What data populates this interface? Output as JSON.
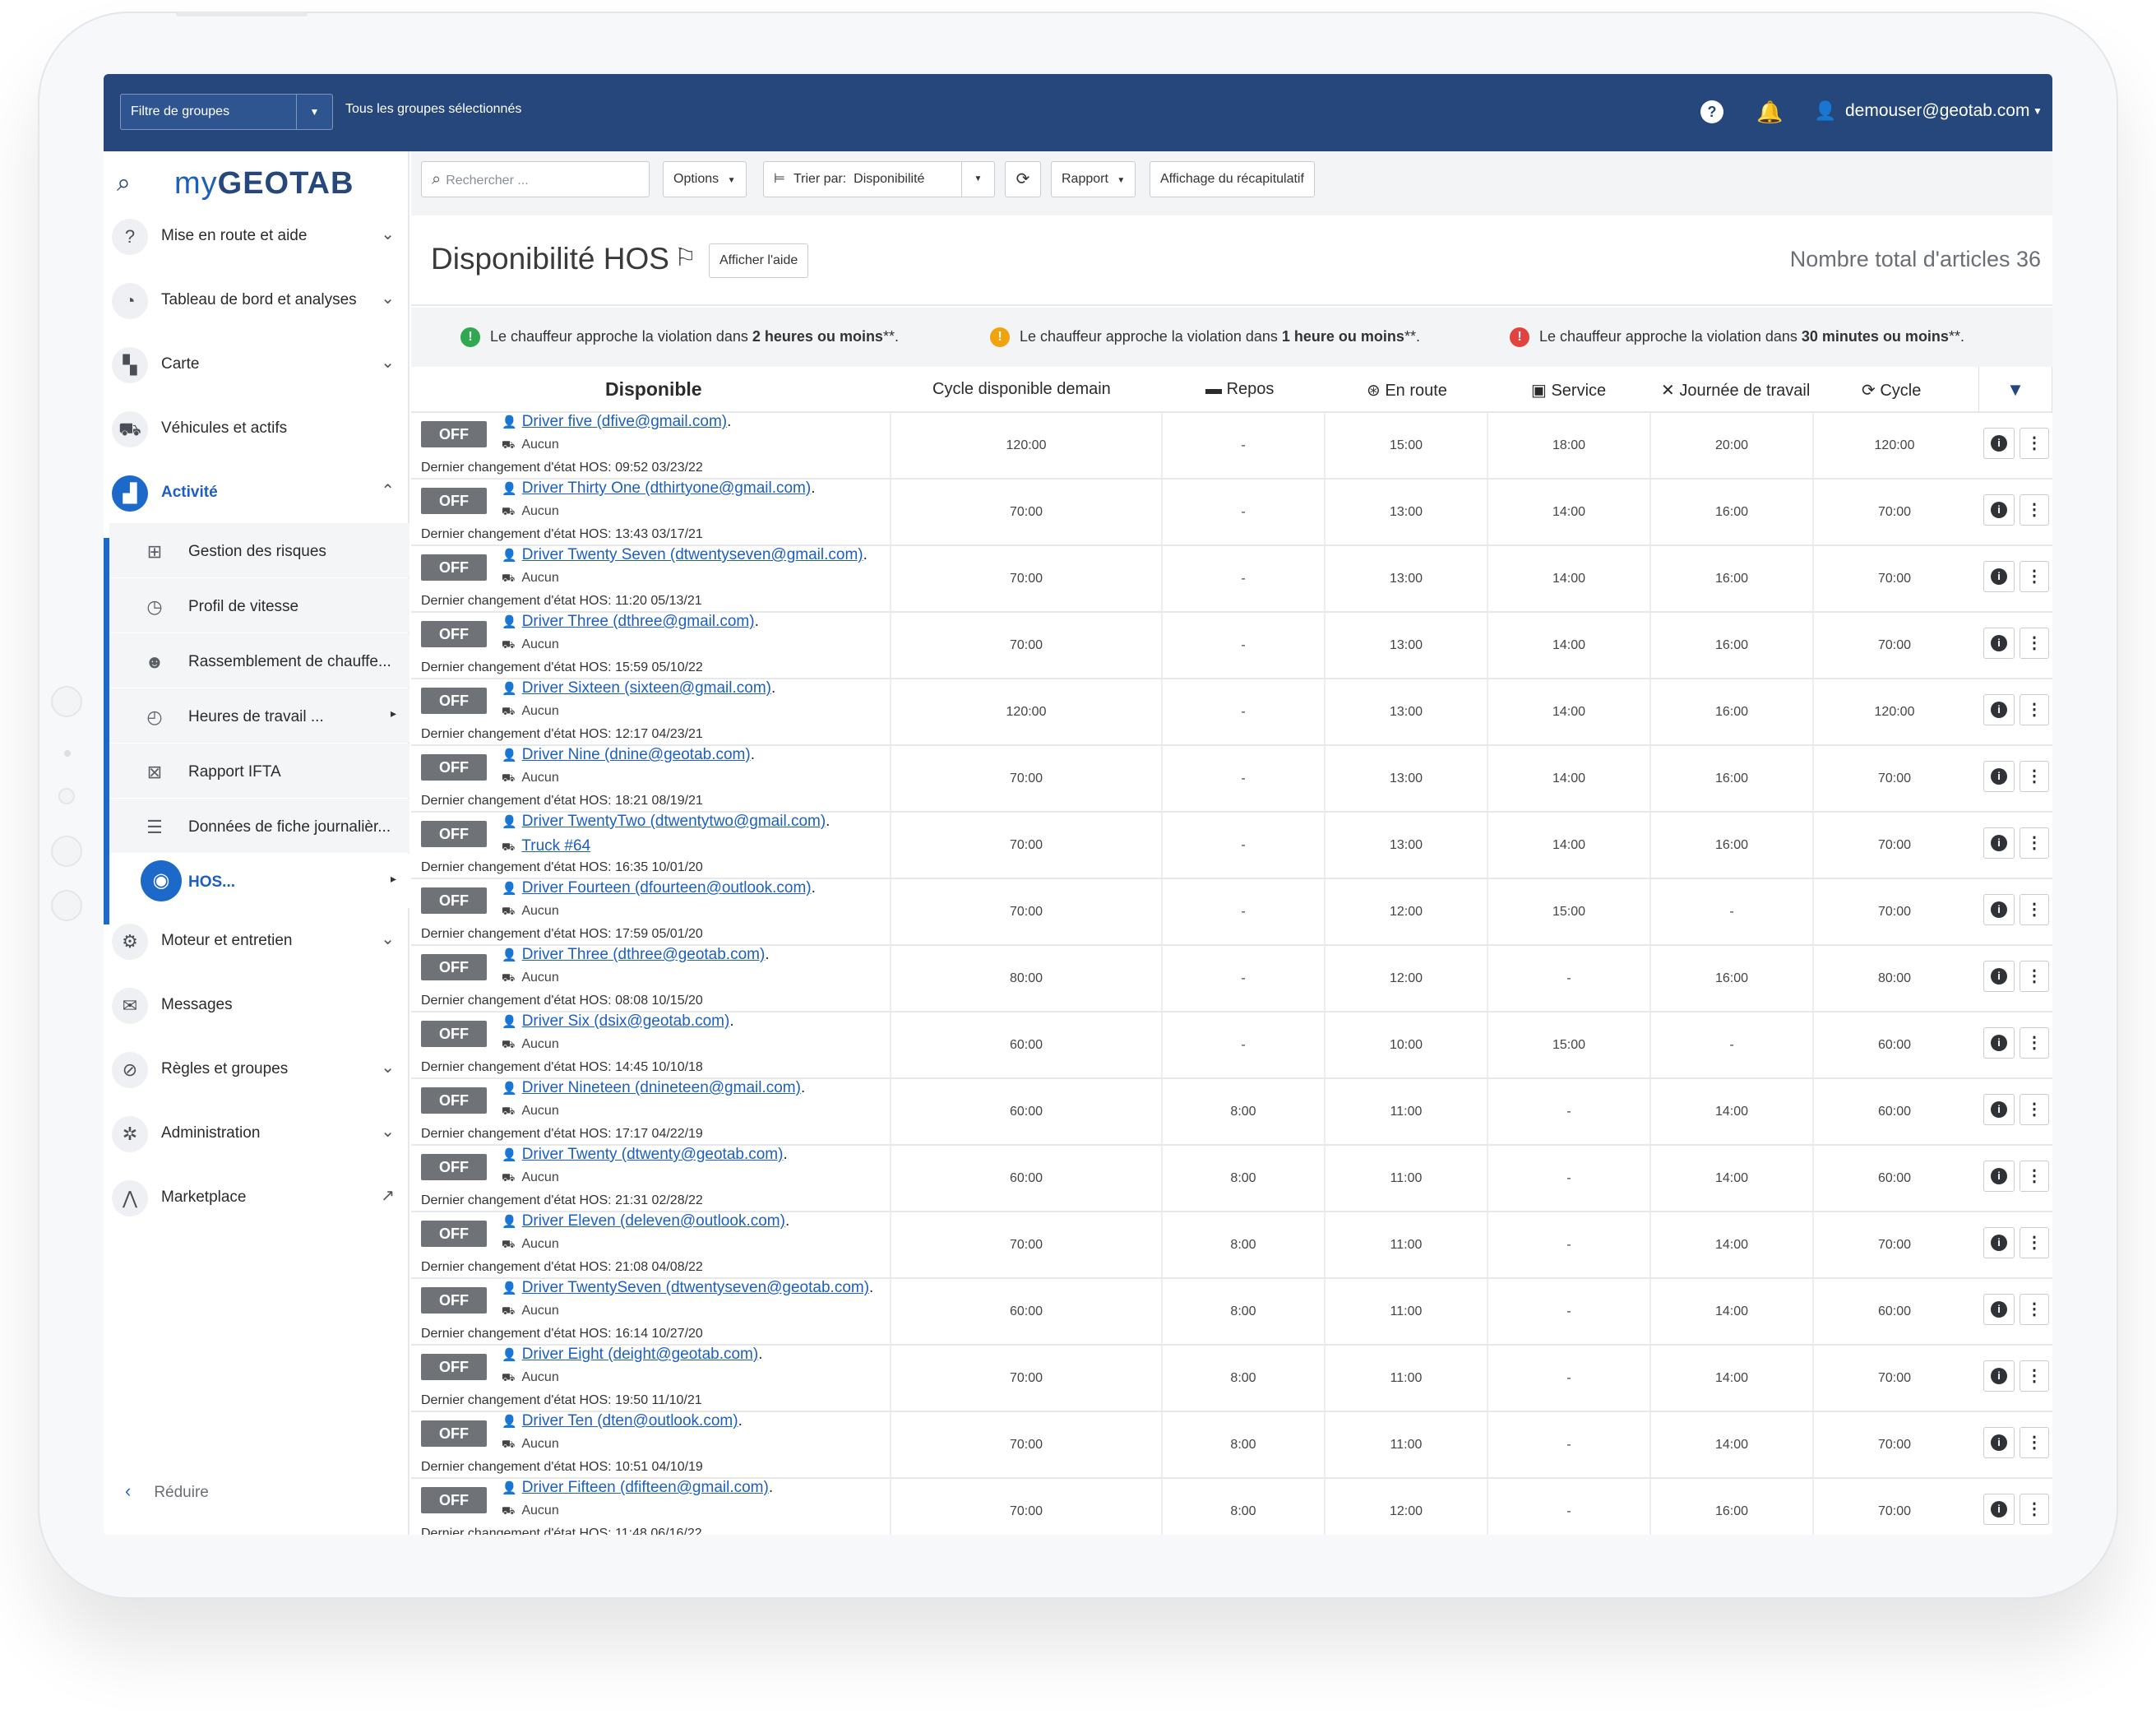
{
  "topbar": {
    "group_filter_label": "Filtre de groupes",
    "all_groups": "Tous les groupes sélectionnés",
    "user_email": "demouser@geotab.com"
  },
  "logo": {
    "my": "my",
    "brand": "GEOTAB"
  },
  "sidebar": {
    "items": [
      {
        "label": "Mise en route et aide",
        "icon": "help-circle-icon",
        "glyph": "?",
        "chevron": true
      },
      {
        "label": "Tableau de bord et analyses",
        "icon": "dashboard-icon",
        "glyph": "◔",
        "chevron": true
      },
      {
        "label": "Carte",
        "icon": "map-icon",
        "glyph": "▚",
        "chevron": true
      },
      {
        "label": "Véhicules et actifs",
        "icon": "truck-icon",
        "glyph": "⛟",
        "chevron": false
      },
      {
        "label": "Activité",
        "icon": "activity-chart-icon",
        "glyph": "▟",
        "chevron": true,
        "active": true
      }
    ],
    "sub_items": [
      {
        "label": "Gestion des risques",
        "icon": "risk-icon",
        "glyph": "⊞"
      },
      {
        "label": "Profil de vitesse",
        "icon": "speed-icon",
        "glyph": "◷"
      },
      {
        "label": "Rassemblement de chauffe...",
        "icon": "people-icon",
        "glyph": "☻"
      },
      {
        "label": "Heures de travail ...",
        "icon": "clock-icon",
        "glyph": "◴",
        "arrow": true
      },
      {
        "label": "Rapport IFTA",
        "icon": "ifta-icon",
        "glyph": "⊠"
      },
      {
        "label": "Données de fiche journalièr...",
        "icon": "log-icon",
        "glyph": "☰"
      },
      {
        "label": "HOS...",
        "icon": "stopwatch-icon",
        "glyph": "◉",
        "arrow": true,
        "active": true
      }
    ],
    "items_after": [
      {
        "label": "Moteur et entretien",
        "icon": "engine-icon",
        "glyph": "⚙",
        "chevron": true
      },
      {
        "label": "Messages",
        "icon": "envelope-icon",
        "glyph": "✉",
        "chevron": false
      },
      {
        "label": "Règles et groupes",
        "icon": "rules-icon",
        "glyph": "⊘",
        "chevron": true
      },
      {
        "label": "Administration",
        "icon": "gear-icon",
        "glyph": "✲",
        "chevron": true
      },
      {
        "label": "Marketplace",
        "icon": "marketplace-icon",
        "glyph": "⋀",
        "external": true
      }
    ],
    "reduce_label": "Réduire"
  },
  "toolbar": {
    "search_placeholder": "Rechercher ...",
    "options": "Options",
    "sort_label": "Trier par:",
    "sort_value": "Disponibilité",
    "report": "Rapport",
    "summary": "Affichage du récapitulatif"
  },
  "page": {
    "title": "Disponibilité HOS",
    "help_button": "Afficher l'aide",
    "total": "Nombre total d'articles 36"
  },
  "legend": [
    {
      "color": "#2fa84f",
      "glyph": "!",
      "text": "Le chauffeur approche la violation dans ",
      "bold": "2 heures ou moins",
      "suffix": "**."
    },
    {
      "color": "#f0a20f",
      "glyph": "!",
      "text": "Le chauffeur approche la violation dans ",
      "bold": "1 heure ou moins",
      "suffix": "**."
    },
    {
      "color": "#e2433f",
      "glyph": "!",
      "text": "Le chauffeur approche la violation dans ",
      "bold": "30 minutes ou moins",
      "suffix": "**."
    }
  ],
  "columns": {
    "available": "Disponible",
    "cycle_tomorrow": "Cycle disponible demain",
    "rest": "Repos",
    "driving": "En route",
    "service": "Service",
    "workday": "Journée de travail",
    "cycle": "Cycle"
  },
  "status_label": "OFF",
  "last_change_prefix": "Dernier changement d'état HOS: ",
  "rows": [
    {
      "driver": "Driver five (dfive@gmail.com)",
      "vehicle": "Aucun",
      "changed": "09:52 03/23/22",
      "ct": "120:00",
      "rest": "-",
      "drive": "15:00",
      "svc": "18:00",
      "work": "20:00",
      "cycle": "120:00"
    },
    {
      "driver": "Driver Thirty One (dthirtyone@gmail.com)",
      "vehicle": "Aucun",
      "changed": "13:43 03/17/21",
      "ct": "70:00",
      "rest": "-",
      "drive": "13:00",
      "svc": "14:00",
      "work": "16:00",
      "cycle": "70:00"
    },
    {
      "driver": "Driver Twenty Seven (dtwentyseven@gmail.com)",
      "vehicle": "Aucun",
      "changed": "11:20 05/13/21",
      "ct": "70:00",
      "rest": "-",
      "drive": "13:00",
      "svc": "14:00",
      "work": "16:00",
      "cycle": "70:00"
    },
    {
      "driver": "Driver Three (dthree@gmail.com)",
      "vehicle": "Aucun",
      "changed": "15:59 05/10/22",
      "ct": "70:00",
      "rest": "-",
      "drive": "13:00",
      "svc": "14:00",
      "work": "16:00",
      "cycle": "70:00"
    },
    {
      "driver": "Driver Sixteen (sixteen@gmail.com)",
      "vehicle": "Aucun",
      "changed": "12:17 04/23/21",
      "ct": "120:00",
      "rest": "-",
      "drive": "13:00",
      "svc": "14:00",
      "work": "16:00",
      "cycle": "120:00"
    },
    {
      "driver": "Driver Nine (dnine@geotab.com)",
      "vehicle": "Aucun",
      "changed": "18:21 08/19/21",
      "ct": "70:00",
      "rest": "-",
      "drive": "13:00",
      "svc": "14:00",
      "work": "16:00",
      "cycle": "70:00"
    },
    {
      "driver": "Driver TwentyTwo (dtwentytwo@gmail.com)",
      "vehicle": "Truck #64",
      "vehicle_link": true,
      "changed": "16:35 10/01/20",
      "ct": "70:00",
      "rest": "-",
      "drive": "13:00",
      "svc": "14:00",
      "work": "16:00",
      "cycle": "70:00"
    },
    {
      "driver": "Driver Fourteen (dfourteen@outlook.com)",
      "vehicle": "Aucun",
      "changed": "17:59 05/01/20",
      "ct": "70:00",
      "rest": "-",
      "drive": "12:00",
      "svc": "15:00",
      "work": "-",
      "cycle": "70:00"
    },
    {
      "driver": "Driver Three (dthree@geotab.com)",
      "vehicle": "Aucun",
      "changed": "08:08 10/15/20",
      "ct": "80:00",
      "rest": "-",
      "drive": "12:00",
      "svc": "-",
      "work": "16:00",
      "cycle": "80:00"
    },
    {
      "driver": "Driver Six (dsix@geotab.com)",
      "vehicle": "Aucun",
      "changed": "14:45 10/10/18",
      "ct": "60:00",
      "rest": "-",
      "drive": "10:00",
      "svc": "15:00",
      "work": "-",
      "cycle": "60:00"
    },
    {
      "driver": "Driver Nineteen (dnineteen@gmail.com)",
      "vehicle": "Aucun",
      "changed": "17:17 04/22/19",
      "ct": "60:00",
      "rest": "8:00",
      "drive": "11:00",
      "svc": "-",
      "work": "14:00",
      "cycle": "60:00"
    },
    {
      "driver": "Driver Twenty (dtwenty@geotab.com)",
      "vehicle": "Aucun",
      "changed": "21:31 02/28/22",
      "ct": "60:00",
      "rest": "8:00",
      "drive": "11:00",
      "svc": "-",
      "work": "14:00",
      "cycle": "60:00"
    },
    {
      "driver": "Driver Eleven (deleven@outlook.com)",
      "vehicle": "Aucun",
      "changed": "21:08 04/08/22",
      "ct": "70:00",
      "rest": "8:00",
      "drive": "11:00",
      "svc": "-",
      "work": "14:00",
      "cycle": "70:00"
    },
    {
      "driver": "Driver TwentySeven (dtwentyseven@geotab.com)",
      "vehicle": "Aucun",
      "changed": "16:14 10/27/20",
      "ct": "60:00",
      "rest": "8:00",
      "drive": "11:00",
      "svc": "-",
      "work": "14:00",
      "cycle": "60:00"
    },
    {
      "driver": "Driver Eight (deight@geotab.com)",
      "vehicle": "Aucun",
      "changed": "19:50 11/10/21",
      "ct": "70:00",
      "rest": "8:00",
      "drive": "11:00",
      "svc": "-",
      "work": "14:00",
      "cycle": "70:00"
    },
    {
      "driver": "Driver Ten (dten@outlook.com)",
      "vehicle": "Aucun",
      "changed": "10:51 04/10/19",
      "ct": "70:00",
      "rest": "8:00",
      "drive": "11:00",
      "svc": "-",
      "work": "14:00",
      "cycle": "70:00"
    },
    {
      "driver": "Driver Fifteen (dfifteen@gmail.com)",
      "vehicle": "Aucun",
      "changed": "11:48 06/16/22",
      "ct": "70:00",
      "rest": "8:00",
      "drive": "12:00",
      "svc": "-",
      "work": "16:00",
      "cycle": "70:00"
    }
  ]
}
